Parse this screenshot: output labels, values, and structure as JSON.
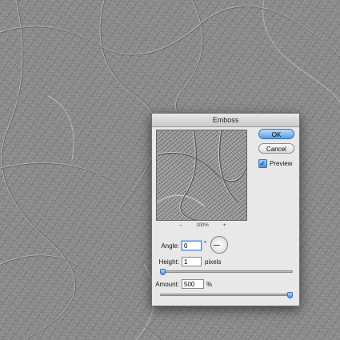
{
  "dialog": {
    "title": "Emboss",
    "ok_label": "OK",
    "cancel_label": "Cancel",
    "preview_label": "Preview",
    "preview_checked": true,
    "zoom": {
      "minus": "–",
      "level": "100%",
      "plus": "+"
    },
    "angle": {
      "label": "Angle:",
      "value": "0",
      "unit": "°"
    },
    "height": {
      "label": "Height:",
      "value": "1",
      "unit": "pixels",
      "slider_fraction": 0.0
    },
    "amount": {
      "label": "Amount:",
      "value": "500",
      "unit": "%",
      "slider_fraction": 1.0
    }
  },
  "icons": {
    "angle_dial": "angle-dial-icon",
    "checkmark": "checkmark-icon"
  },
  "colors": {
    "canvas": "#8b8b8b",
    "dialog_bg": "#e8e8e8",
    "ok_button": "#5a9de6"
  }
}
